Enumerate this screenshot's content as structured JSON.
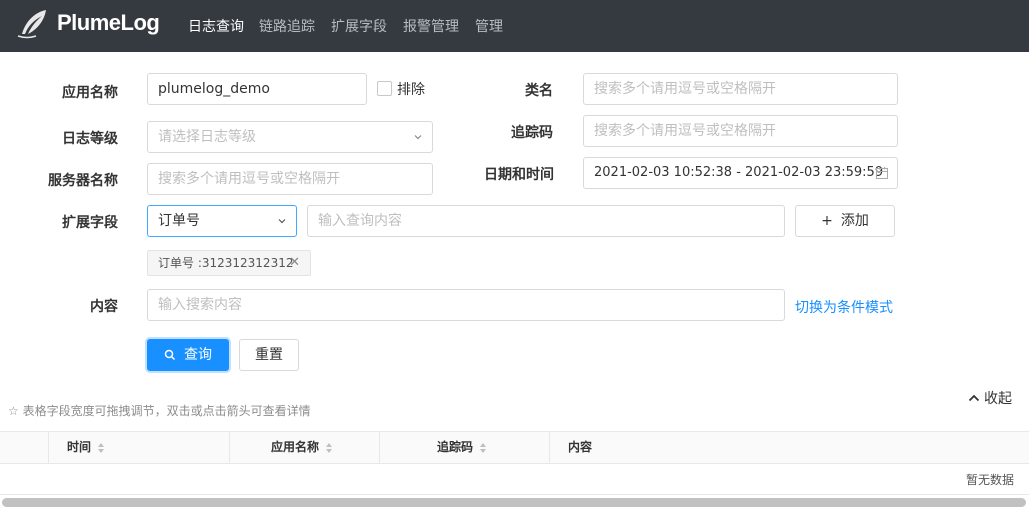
{
  "header": {
    "brand": "PlumeLog",
    "nav": [
      {
        "label": "日志查询",
        "active": true
      },
      {
        "label": "链路追踪",
        "active": false
      },
      {
        "label": "扩展字段",
        "active": false
      },
      {
        "label": "报警管理",
        "active": false
      },
      {
        "label": "管理",
        "active": false
      }
    ]
  },
  "form": {
    "app_name": {
      "label": "应用名称",
      "value": "plumelog_demo"
    },
    "exclude_label": "排除",
    "class_name": {
      "label": "类名",
      "placeholder": "搜索多个请用逗号或空格隔开"
    },
    "log_level": {
      "label": "日志等级",
      "placeholder": "请选择日志等级"
    },
    "trace_id": {
      "label": "追踪码",
      "placeholder": "搜索多个请用逗号或空格隔开"
    },
    "server_name": {
      "label": "服务器名称",
      "placeholder": "搜索多个请用逗号或空格隔开"
    },
    "datetime": {
      "label": "日期和时间",
      "value": "2021-02-03 10:52:38 - 2021-02-03 23:59:59"
    },
    "ext_field": {
      "label": "扩展字段",
      "selected": "订单号",
      "placeholder": "输入查询内容",
      "add_label": "添加"
    },
    "tag": {
      "text": "订单号 :312312312312"
    },
    "content": {
      "label": "内容",
      "placeholder": "输入搜索内容",
      "switch_link": "切换为条件模式"
    },
    "search_label": "查询",
    "reset_label": "重置"
  },
  "table": {
    "hint": "☆ 表格字段宽度可拖拽调节，双击或点击箭头可查看详情",
    "collapse_label": "收起",
    "columns": [
      "时间",
      "应用名称",
      "追踪码",
      "内容"
    ],
    "empty_text": "暂无数据"
  },
  "colors": {
    "topbar": "#343a40",
    "primary": "#1890ff"
  }
}
